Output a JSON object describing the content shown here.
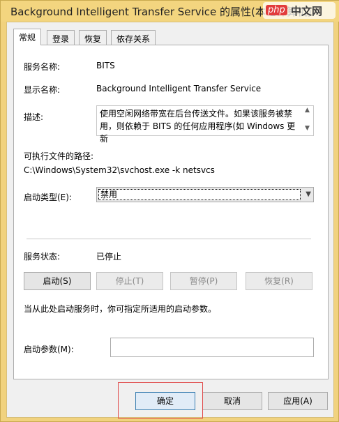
{
  "window": {
    "title": "Background Intelligent Transfer Service 的属性(本地计算机)",
    "watermark_logo": "php",
    "watermark_site": "中文网"
  },
  "tabs": [
    {
      "label": "常规",
      "active": true
    },
    {
      "label": "登录",
      "active": false
    },
    {
      "label": "恢复",
      "active": false
    },
    {
      "label": "依存关系",
      "active": false
    }
  ],
  "general": {
    "service_name_label": "服务名称:",
    "service_name": "BITS",
    "display_name_label": "显示名称:",
    "display_name": "Background Intelligent Transfer Service",
    "description_label": "描述:",
    "description": "使用空闲网络带宽在后台传送文件。如果该服务被禁用，则依赖于 BITS 的任何应用程序(如 Windows 更新",
    "exec_path_label": "可执行文件的路径:",
    "exec_path": "C:\\Windows\\System32\\svchost.exe -k netsvcs",
    "startup_type_label": "启动类型(E):",
    "startup_type": "禁用",
    "status_label": "服务状态:",
    "status": "已停止",
    "start_button": "启动(S)",
    "stop_button": "停止(T)",
    "pause_button": "暂停(P)",
    "resume_button": "恢复(R)",
    "hint": "当从此处启动服务时，你可指定所适用的启动参数。",
    "params_label": "启动参数(M):",
    "params_value": ""
  },
  "footer": {
    "ok_button": "确定",
    "cancel_button": "取消",
    "apply_button": "应用(A)"
  },
  "colors": {
    "titlebar": "#f3d57f",
    "highlight_frame": "#e04848"
  }
}
